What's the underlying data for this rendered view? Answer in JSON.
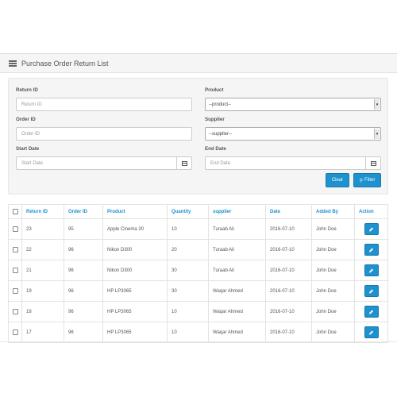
{
  "panel": {
    "title": "Purchase Order Return List",
    "icon": "list-icon"
  },
  "filters": {
    "return_id": {
      "label": "Return ID",
      "placeholder": "Return ID"
    },
    "product": {
      "label": "Product",
      "selected": "--product--"
    },
    "order_id": {
      "label": "Order ID",
      "placeholder": "Order ID"
    },
    "supplier": {
      "label": "Supplier",
      "selected": "--supplier--"
    },
    "start_date": {
      "label": "Start Date",
      "placeholder": "Start Date"
    },
    "end_date": {
      "label": "End Date",
      "placeholder": "End Date"
    },
    "clear_label": "Clear",
    "filter_label": "Filter"
  },
  "table": {
    "headers": [
      "Return ID",
      "Order ID",
      "Product",
      "Quantity",
      "supplier",
      "Date",
      "Added By",
      "Action"
    ],
    "rows": [
      [
        "23",
        "95",
        "Apple Cinema 30",
        "10",
        "Turaab Ali",
        "2016-07-10",
        "John Doe"
      ],
      [
        "22",
        "96",
        "Nikon D300",
        "20",
        "Turaab Ali",
        "2016-07-10",
        "John Doe"
      ],
      [
        "21",
        "96",
        "Nikon D300",
        "30",
        "Turaab Ali",
        "2016-07-10",
        "John Doe"
      ],
      [
        "19",
        "96",
        "HP LP3065",
        "30",
        "Waqar Ahmed",
        "2016-07-10",
        "John Doe"
      ],
      [
        "18",
        "96",
        "HP LP3065",
        "10",
        "Waqar Ahmed",
        "2016-07-10",
        "John Doe"
      ],
      [
        "17",
        "96",
        "HP LP3065",
        "10",
        "Waqar Ahmed",
        "2016-07-10",
        "John Doe"
      ]
    ]
  },
  "colors": {
    "accent": "#1e91cf",
    "heading_bg": "#f5f5f5"
  }
}
